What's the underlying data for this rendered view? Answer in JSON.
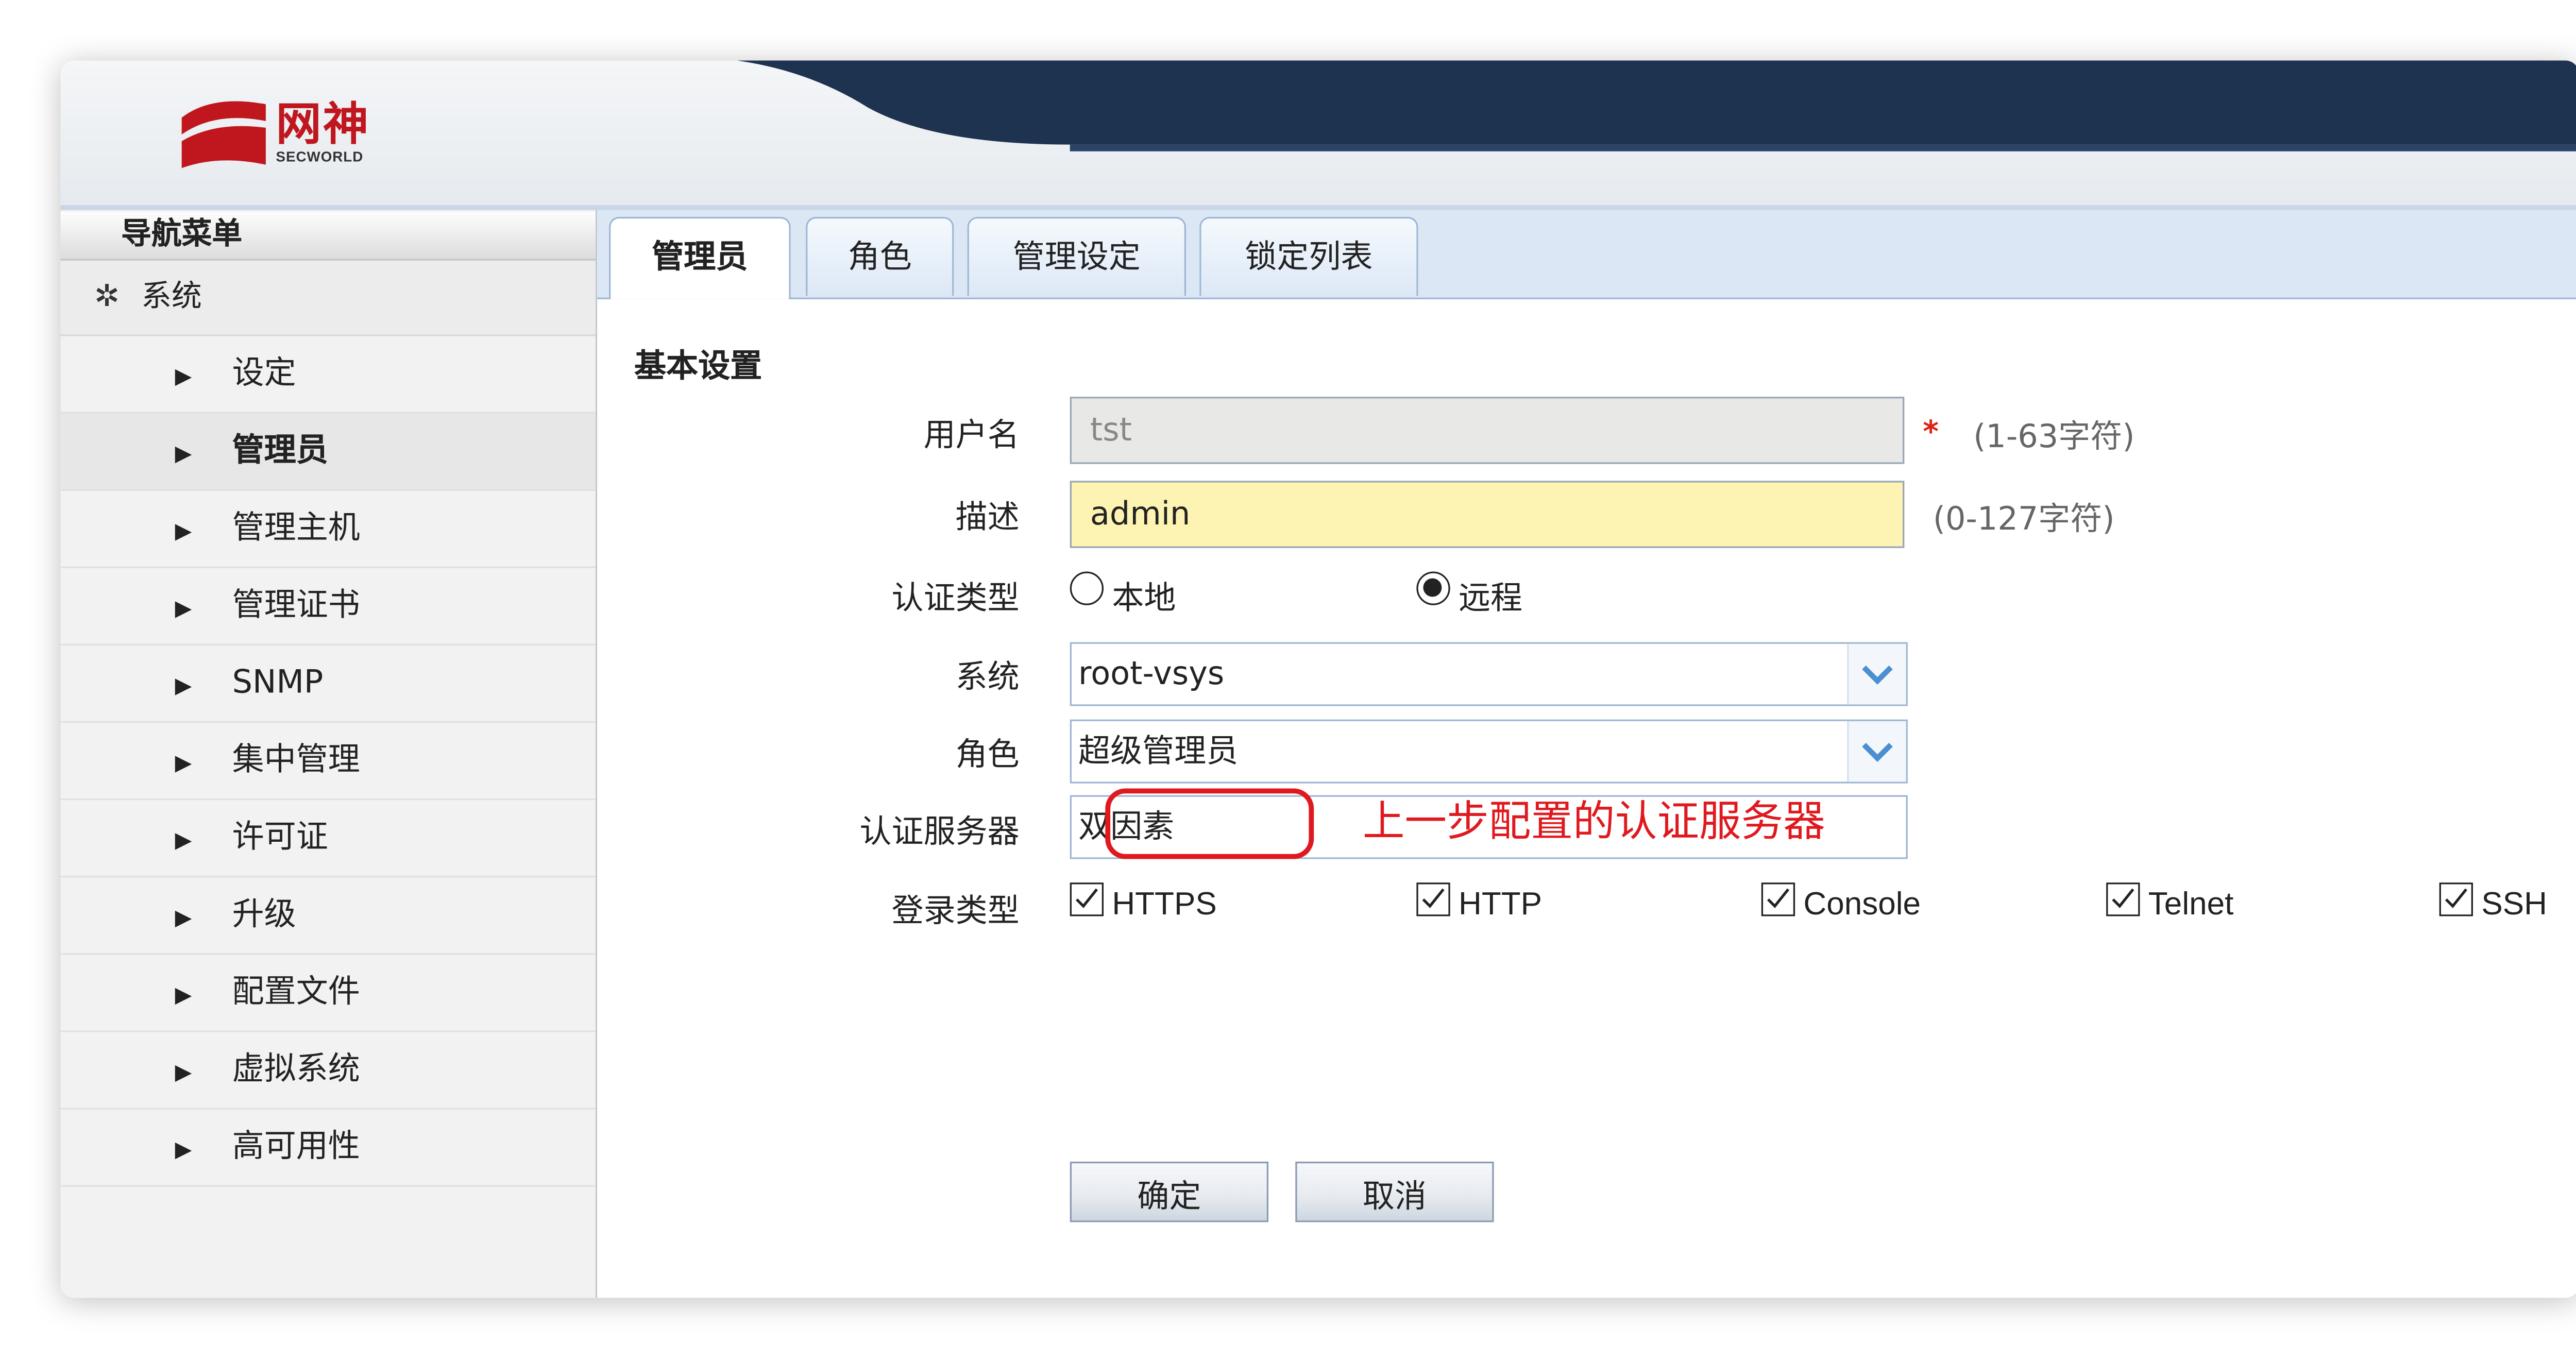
{
  "header": {
    "logo_text_cn": "网神",
    "logo_text_en": "SECWORLD"
  },
  "sidebar": {
    "title": "导航菜单",
    "section": {
      "label": "系统",
      "icon": "gear-icon"
    },
    "items": [
      {
        "label": "设定",
        "active": false
      },
      {
        "label": "管理员",
        "active": true
      },
      {
        "label": "管理主机",
        "active": false
      },
      {
        "label": "管理证书",
        "active": false
      },
      {
        "label": "SNMP",
        "active": false
      },
      {
        "label": "集中管理",
        "active": false
      },
      {
        "label": "许可证",
        "active": false
      },
      {
        "label": "升级",
        "active": false
      },
      {
        "label": "配置文件",
        "active": false
      },
      {
        "label": "虚拟系统",
        "active": false
      },
      {
        "label": "高可用性",
        "active": false
      }
    ]
  },
  "tabs": [
    {
      "label": "管理员",
      "active": true
    },
    {
      "label": "角色",
      "active": false
    },
    {
      "label": "管理设定",
      "active": false
    },
    {
      "label": "锁定列表",
      "active": false
    }
  ],
  "form": {
    "section_title": "基本设置",
    "username": {
      "label": "用户名",
      "value": "tst",
      "required_mark": "*",
      "hint": "(1-63字符)"
    },
    "description": {
      "label": "描述",
      "value": "admin",
      "hint": "(0-127字符)"
    },
    "auth_type": {
      "label": "认证类型",
      "options": [
        {
          "label": "本地",
          "checked": false
        },
        {
          "label": "远程",
          "checked": true
        }
      ]
    },
    "system": {
      "label": "系统",
      "value": "root-vsys"
    },
    "role": {
      "label": "角色",
      "value": "超级管理员"
    },
    "auth_server": {
      "label": "认证服务器",
      "value": "双因素"
    },
    "login_type": {
      "label": "登录类型",
      "options": [
        {
          "label": "HTTPS",
          "checked": true
        },
        {
          "label": "HTTP",
          "checked": true
        },
        {
          "label": "Console",
          "checked": true
        },
        {
          "label": "Telnet",
          "checked": true
        },
        {
          "label": "SSH",
          "checked": true
        }
      ]
    },
    "ok_label": "确定",
    "cancel_label": "取消"
  },
  "annotation": {
    "text": "上一步配置的认证服务器",
    "color": "#e0191f"
  },
  "colors": {
    "header_band": "#1e3350",
    "brand_red": "#c0171f",
    "tab_bar": "#dbe7f5",
    "input_highlight": "#fdf3b3"
  }
}
